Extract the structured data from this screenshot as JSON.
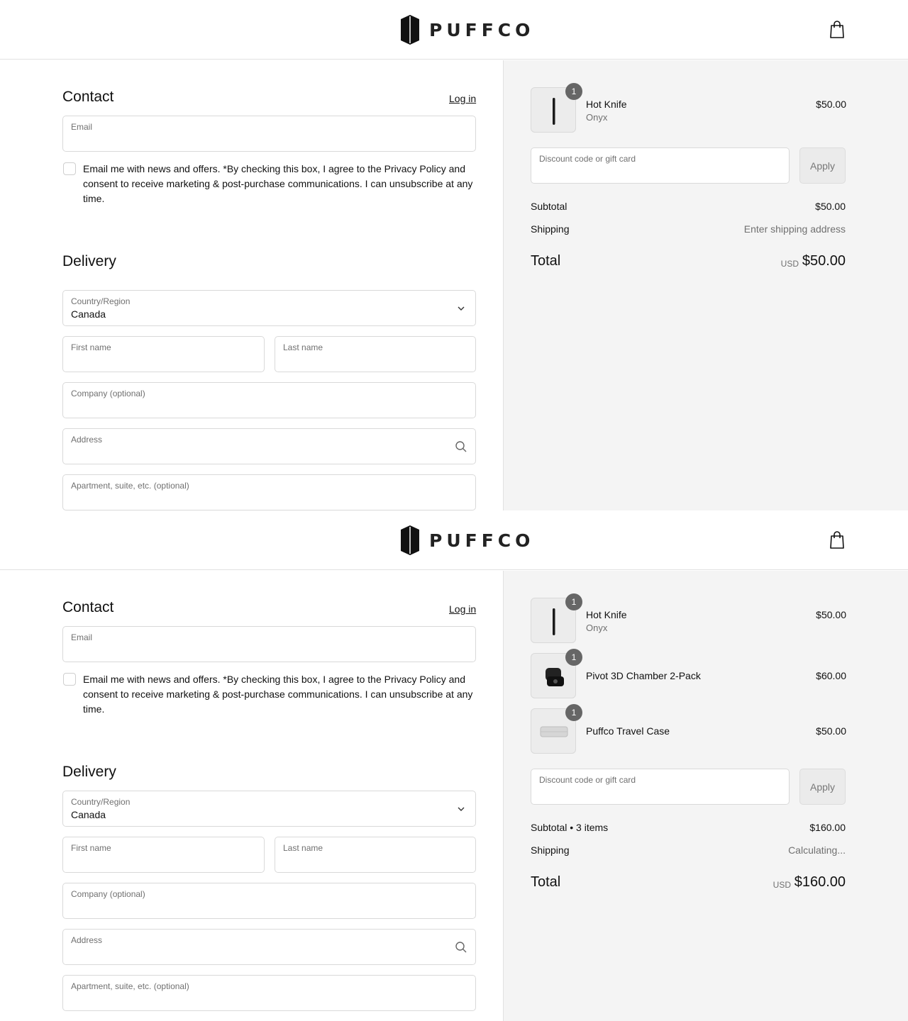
{
  "brand": {
    "name": "PUFFCO"
  },
  "icons": {
    "logo": "puffco-logo-icon",
    "cart": "shopping-bag-icon",
    "chevron": "chevron-down-icon",
    "search": "search-icon"
  },
  "colors": {
    "summary_bg": "#f4f4f4",
    "badge": "#666666",
    "border": "#d9d9d9"
  },
  "screens": [
    {
      "contact": {
        "title": "Contact",
        "login_label": "Log in",
        "email_label": "Email",
        "newsletter_text": "Email me with news and offers. *By checking this box, I agree to the Privacy Policy and consent to receive marketing & post-purchase communications. I can unsubscribe at any time."
      },
      "delivery": {
        "title": "Delivery",
        "country_label": "Country/Region",
        "country_value": "Canada",
        "first_name_label": "First name",
        "last_name_label": "Last name",
        "company_label": "Company (optional)",
        "address_label": "Address",
        "apartment_label": "Apartment, suite, etc. (optional)"
      },
      "summary": {
        "items": [
          {
            "name": "Hot Knife",
            "variant": "Onyx",
            "price": "$50.00",
            "qty": "1"
          }
        ],
        "discount_label": "Discount code or gift card",
        "apply_label": "Apply",
        "subtotal_label": "Subtotal",
        "subtotal_value": "$50.00",
        "shipping_label": "Shipping",
        "shipping_value": "Enter shipping address",
        "total_label": "Total",
        "currency": "USD",
        "total_value": "$50.00"
      }
    },
    {
      "contact": {
        "title": "Contact",
        "login_label": "Log in",
        "email_label": "Email",
        "newsletter_text": "Email me with news and offers. *By checking this box, I agree to the Privacy Policy and consent to receive marketing & post-purchase communications. I can unsubscribe at any time."
      },
      "delivery": {
        "title": "Delivery",
        "country_label": "Country/Region",
        "country_value": "Canada",
        "first_name_label": "First name",
        "last_name_label": "Last name",
        "company_label": "Company (optional)",
        "address_label": "Address",
        "apartment_label": "Apartment, suite, etc. (optional)"
      },
      "summary": {
        "items": [
          {
            "name": "Hot Knife",
            "variant": "Onyx",
            "price": "$50.00",
            "qty": "1"
          },
          {
            "name": "Pivot 3D Chamber 2-Pack",
            "variant": "",
            "price": "$60.00",
            "qty": "1"
          },
          {
            "name": "Puffco Travel Case",
            "variant": "",
            "price": "$50.00",
            "qty": "1"
          }
        ],
        "discount_label": "Discount code or gift card",
        "apply_label": "Apply",
        "subtotal_label": "Subtotal • 3 items",
        "subtotal_value": "$160.00",
        "shipping_label": "Shipping",
        "shipping_value": "Calculating...",
        "total_label": "Total",
        "currency": "USD",
        "total_value": "$160.00"
      }
    }
  ]
}
